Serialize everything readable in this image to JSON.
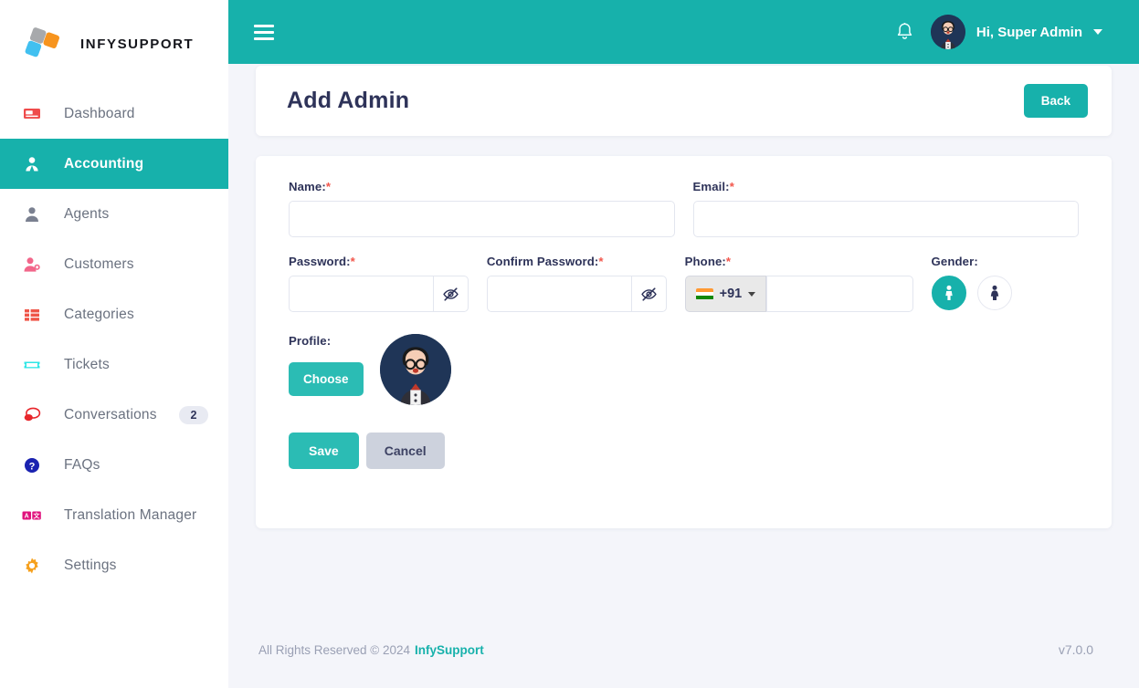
{
  "brand": {
    "name": "INFYSUPPORT",
    "logo_icon": "infy-logo-icon"
  },
  "sidebar": {
    "items": [
      {
        "label": "Dashboard",
        "icon": "dashboard-icon",
        "active": false,
        "badge": null
      },
      {
        "label": "Accounting",
        "icon": "accounting-icon",
        "active": true,
        "badge": null
      },
      {
        "label": "Agents",
        "icon": "agents-icon",
        "active": false,
        "badge": null
      },
      {
        "label": "Customers",
        "icon": "customers-icon",
        "active": false,
        "badge": null
      },
      {
        "label": "Categories",
        "icon": "categories-icon",
        "active": false,
        "badge": null
      },
      {
        "label": "Tickets",
        "icon": "tickets-icon",
        "active": false,
        "badge": null
      },
      {
        "label": "Conversations",
        "icon": "conversations-icon",
        "active": false,
        "badge": "2"
      },
      {
        "label": "FAQs",
        "icon": "faqs-icon",
        "active": false,
        "badge": null
      },
      {
        "label": "Translation Manager",
        "icon": "translation-manager-icon",
        "active": false,
        "badge": null
      },
      {
        "label": "Settings",
        "icon": "settings-gear-icon",
        "active": false,
        "badge": null
      }
    ]
  },
  "topbar": {
    "menu_toggle_icon": "hamburger-icon",
    "notification_icon": "bell-icon",
    "user_greeting": "Hi, Super Admin",
    "user_avatar_icon": "avatar-icon",
    "dropdown_icon": "chevron-down-icon"
  },
  "page": {
    "title": "Add Admin",
    "back_label": "Back"
  },
  "form": {
    "name": {
      "label": "Name:",
      "required": "*",
      "value": "",
      "placeholder": ""
    },
    "email": {
      "label": "Email:",
      "required": "*",
      "value": "",
      "placeholder": ""
    },
    "password": {
      "label": "Password:",
      "required": "*",
      "value": "",
      "placeholder": "",
      "toggle_icon": "eye-slash-icon"
    },
    "confirm_password": {
      "label": "Confirm Password:",
      "required": "*",
      "value": "",
      "placeholder": "",
      "toggle_icon": "eye-slash-icon"
    },
    "phone": {
      "label": "Phone:",
      "required": "*",
      "value": "",
      "placeholder": "",
      "country_code": "+91",
      "country_flag_icon": "india-flag-icon",
      "dropdown_icon": "caret-down-icon"
    },
    "gender": {
      "label": "Gender:",
      "options": [
        {
          "name": "male",
          "icon": "male-icon",
          "selected": true
        },
        {
          "name": "female",
          "icon": "female-icon",
          "selected": false
        }
      ]
    },
    "profile": {
      "label": "Profile:",
      "choose_label": "Choose",
      "preview_icon": "avatar-icon"
    },
    "save_label": "Save",
    "cancel_label": "Cancel"
  },
  "footer": {
    "copyright": "All Rights Reserved © 2024",
    "brand_link": "InfySupport",
    "version": "v7.0.0"
  },
  "colors": {
    "accent": "#17b1ab",
    "accent_light": "#2bbcb4",
    "sidebar_bg": "#ffffff",
    "page_bg": "#f4f5fa",
    "title": "#2e3359",
    "required": "#f2574c",
    "muted": "#6b7280",
    "cancel": "#cdd2dd"
  }
}
